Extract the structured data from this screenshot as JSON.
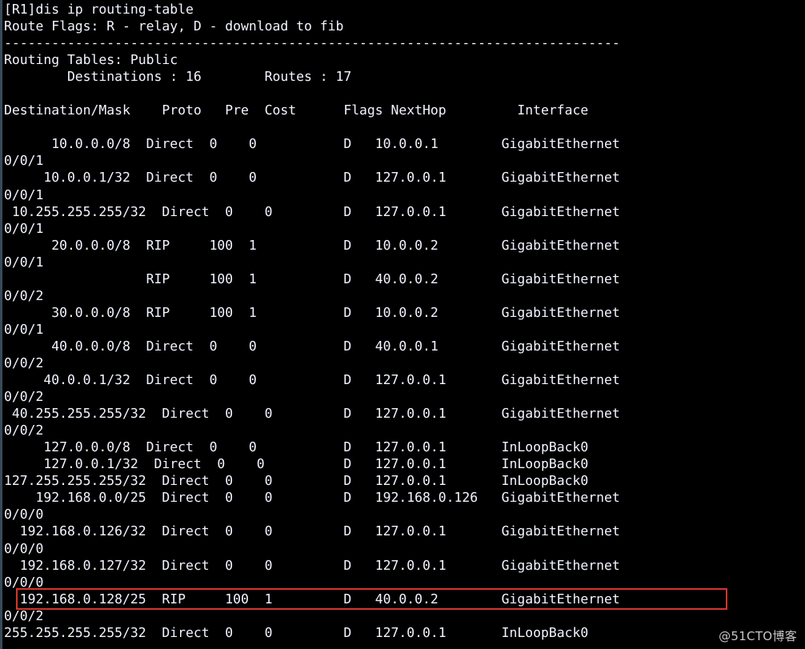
{
  "terminal": {
    "background_color": "#000000",
    "text_color": "#f2f4ff",
    "prompt": "[R1]",
    "command": "dis ip routing-table",
    "command_line": "[R1]dis ip routing-table",
    "route_flags_line": "Route Flags: R - relay, D - download to fib",
    "separator": "------------------------------------------------------------------------------",
    "routing_tables_line": "Routing Tables: Public",
    "summary_line": "        Destinations : 16        Routes : 17",
    "destinations_count": "16",
    "routes_count": "17",
    "columns": [
      "Destination/Mask",
      "Proto",
      "Pre",
      "Cost",
      "Flags",
      "NextHop",
      "Interface"
    ],
    "header_line": "Destination/Mask    Proto   Pre  Cost      Flags NextHop         Interface",
    "rows": [
      {
        "destination": "10.0.0.0/8",
        "proto": "Direct",
        "pre": "0",
        "cost": "0",
        "flags": "D",
        "nexthop": "10.0.0.1",
        "interface": "GigabitEthernet0/0/1",
        "wrapped": true
      },
      {
        "destination": "10.0.0.1/32",
        "proto": "Direct",
        "pre": "0",
        "cost": "0",
        "flags": "D",
        "nexthop": "127.0.0.1",
        "interface": "GigabitEthernet0/0/1",
        "wrapped": true
      },
      {
        "destination": "10.255.255.255/32",
        "proto": "Direct",
        "pre": "0",
        "cost": "0",
        "flags": "D",
        "nexthop": "127.0.0.1",
        "interface": "GigabitEthernet0/0/1",
        "wrapped": true
      },
      {
        "destination": "20.0.0.0/8",
        "proto": "RIP",
        "pre": "100",
        "cost": "1",
        "flags": "D",
        "nexthop": "10.0.0.2",
        "interface": "GigabitEthernet0/0/1",
        "wrapped": true
      },
      {
        "destination": "",
        "proto": "RIP",
        "pre": "100",
        "cost": "1",
        "flags": "D",
        "nexthop": "40.0.0.2",
        "interface": "GigabitEthernet0/0/2",
        "wrapped": true
      },
      {
        "destination": "30.0.0.0/8",
        "proto": "RIP",
        "pre": "100",
        "cost": "1",
        "flags": "D",
        "nexthop": "10.0.0.2",
        "interface": "GigabitEthernet0/0/1",
        "wrapped": true
      },
      {
        "destination": "40.0.0.0/8",
        "proto": "Direct",
        "pre": "0",
        "cost": "0",
        "flags": "D",
        "nexthop": "40.0.0.1",
        "interface": "GigabitEthernet0/0/2",
        "wrapped": true
      },
      {
        "destination": "40.0.0.1/32",
        "proto": "Direct",
        "pre": "0",
        "cost": "0",
        "flags": "D",
        "nexthop": "127.0.0.1",
        "interface": "GigabitEthernet0/0/2",
        "wrapped": true
      },
      {
        "destination": "40.255.255.255/32",
        "proto": "Direct",
        "pre": "0",
        "cost": "0",
        "flags": "D",
        "nexthop": "127.0.0.1",
        "interface": "GigabitEthernet0/0/2",
        "wrapped": true
      },
      {
        "destination": "127.0.0.0/8",
        "proto": "Direct",
        "pre": "0",
        "cost": "0",
        "flags": "D",
        "nexthop": "127.0.0.1",
        "interface": "InLoopBack0",
        "wrapped": false
      },
      {
        "destination": "127.0.0.1/32",
        "proto": "Direct",
        "pre": "0",
        "cost": "0",
        "flags": "D",
        "nexthop": "127.0.0.1",
        "interface": "InLoopBack0",
        "wrapped": false
      },
      {
        "destination": "127.255.255.255/32",
        "proto": "Direct",
        "pre": "0",
        "cost": "0",
        "flags": "D",
        "nexthop": "127.0.0.1",
        "interface": "InLoopBack0",
        "wrapped": false
      },
      {
        "destination": "192.168.0.0/25",
        "proto": "Direct",
        "pre": "0",
        "cost": "0",
        "flags": "D",
        "nexthop": "192.168.0.126",
        "interface": "GigabitEthernet0/0/0",
        "wrapped": true
      },
      {
        "destination": "192.168.0.126/32",
        "proto": "Direct",
        "pre": "0",
        "cost": "0",
        "flags": "D",
        "nexthop": "127.0.0.1",
        "interface": "GigabitEthernet0/0/0",
        "wrapped": true
      },
      {
        "destination": "192.168.0.127/32",
        "proto": "Direct",
        "pre": "0",
        "cost": "0",
        "flags": "D",
        "nexthop": "127.0.0.1",
        "interface": "GigabitEthernet0/0/0",
        "wrapped": true
      },
      {
        "destination": "192.168.0.128/25",
        "proto": "RIP",
        "pre": "100",
        "cost": "1",
        "flags": "D",
        "nexthop": "40.0.0.2",
        "interface": "GigabitEthernet0/0/2",
        "wrapped": true,
        "highlighted": true
      },
      {
        "destination": "255.255.255.255/32",
        "proto": "Direct",
        "pre": "0",
        "cost": "0",
        "flags": "D",
        "nexthop": "127.0.0.1",
        "interface": "InLoopBack0",
        "wrapped": false
      }
    ],
    "full_text": "[R1]dis ip routing-table\nRoute Flags: R - relay, D - download to fib\n------------------------------------------------------------------------------\nRouting Tables: Public\n        Destinations : 16        Routes : 17\n\nDestination/Mask    Proto   Pre  Cost      Flags NextHop         Interface\n\n      10.0.0.0/8  Direct  0    0           D   10.0.0.1        GigabitEthernet\n0/0/1\n     10.0.0.1/32  Direct  0    0           D   127.0.0.1       GigabitEthernet\n0/0/1\n 10.255.255.255/32  Direct  0    0         D   127.0.0.1       GigabitEthernet\n0/0/1\n      20.0.0.0/8  RIP     100  1           D   10.0.0.2        GigabitEthernet\n0/0/1\n                  RIP     100  1           D   40.0.0.2        GigabitEthernet\n0/0/2\n      30.0.0.0/8  RIP     100  1           D   10.0.0.2        GigabitEthernet\n0/0/1\n      40.0.0.0/8  Direct  0    0           D   40.0.0.1        GigabitEthernet\n0/0/2\n     40.0.0.1/32  Direct  0    0           D   127.0.0.1       GigabitEthernet\n0/0/2\n 40.255.255.255/32  Direct  0    0         D   127.0.0.1       GigabitEthernet\n0/0/2\n     127.0.0.0/8  Direct  0    0           D   127.0.0.1       InLoopBack0\n     127.0.0.1/32  Direct  0    0          D   127.0.0.1       InLoopBack0\n127.255.255.255/32  Direct  0    0         D   127.0.0.1       InLoopBack0\n    192.168.0.0/25  Direct  0    0         D   192.168.0.126   GigabitEthernet\n0/0/0\n  192.168.0.126/32  Direct  0    0         D   127.0.0.1       GigabitEthernet\n0/0/0\n  192.168.0.127/32  Direct  0    0         D   127.0.0.1       GigabitEthernet\n0/0/0\n  192.168.0.128/25  RIP     100  1         D   40.0.0.2        GigabitEthernet\n0/0/2\n255.255.255.255/32  Direct  0    0         D   127.0.0.1       InLoopBack0"
  },
  "annotations": {
    "highlight_color": "#d4362c",
    "highlighted_row": "192.168.0.128/25"
  },
  "watermark": {
    "text": "@51CTO博客"
  }
}
